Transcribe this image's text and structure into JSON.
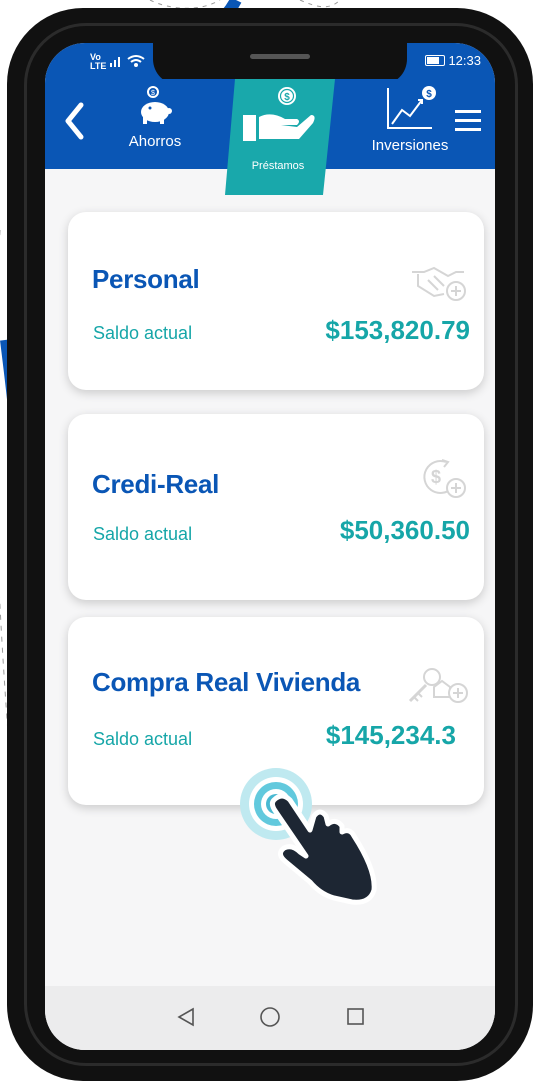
{
  "status_bar": {
    "carrier_top": "Vo",
    "carrier_bottom": "LTE",
    "time": "12:33"
  },
  "nav": {
    "tabs": [
      {
        "label": "Ahorros",
        "icon": "piggy-bank-coin-icon"
      },
      {
        "label": "Préstamos",
        "icon": "hand-coin-icon",
        "active": true
      },
      {
        "label": "Inversiones",
        "icon": "growth-chart-coin-icon"
      }
    ]
  },
  "loans": [
    {
      "title": "Personal",
      "balance_label": "Saldo actual",
      "amount": "$153,820.79",
      "icon": "handshake-plus-icon"
    },
    {
      "title": "Credi-Real",
      "balance_label": "Saldo actual",
      "amount": "$50,360.50",
      "icon": "dollar-cycle-plus-icon"
    },
    {
      "title": "Compra Real Vivienda",
      "balance_label": "Saldo actual",
      "amount": "$145,234.3",
      "icon": "house-key-plus-icon"
    }
  ],
  "colors": {
    "brand_blue": "#0a56b5",
    "accent_teal": "#16a6a8",
    "screen_bg": "#f6f6f7"
  }
}
